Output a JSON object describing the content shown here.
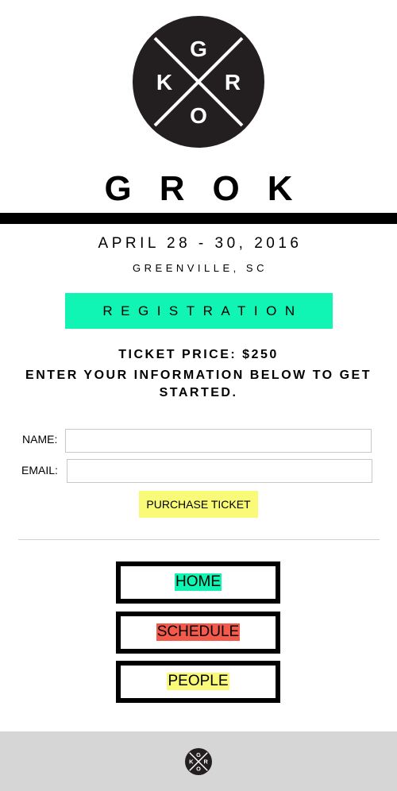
{
  "brand": {
    "logo_letters": {
      "top": "G",
      "left": "K",
      "right": "R",
      "bottom": "O"
    },
    "wordmark": "GROK",
    "logo_color": "#231f20"
  },
  "event": {
    "dates": "APRIL 28 - 30, 2016",
    "location": "GREENVILLE, SC"
  },
  "registration": {
    "banner": "REGISTRATION",
    "banner_color": "#11f5b4",
    "price": "TICKET PRICE: $250",
    "intro": "ENTER YOUR INFORMATION BELOW TO GET STARTED."
  },
  "form": {
    "name_label": "NAME:",
    "name_value": "",
    "email_label": "EMAIL:",
    "email_value": "",
    "submit_label": "PURCHASE TICKET",
    "submit_color": "#f9fb78"
  },
  "nav": [
    {
      "label": "HOME",
      "highlight": "#11f5b4"
    },
    {
      "label": "SCHEDULE",
      "highlight": "#f45a4b"
    },
    {
      "label": "PEOPLE",
      "highlight": "#f9fb78"
    }
  ],
  "footer": {
    "background": "#d6d6d6"
  }
}
